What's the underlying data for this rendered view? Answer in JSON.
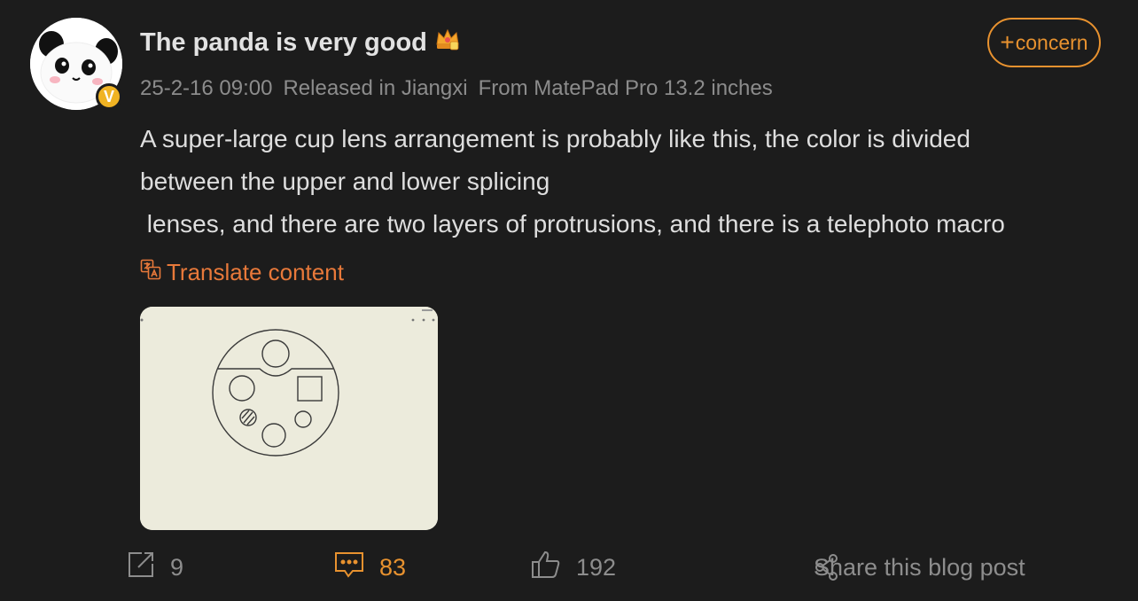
{
  "post": {
    "username": "The panda is very good",
    "timestamp": "25-2-16 09:00",
    "location": "Released in Jiangxi",
    "device": "From MatePad Pro 13.2 inches",
    "follow_label": "concern",
    "follow_plus": "+",
    "verified_badge": "V",
    "content_lines": [
      "A super-large cup lens arrangement is probably like this, the color is divided",
      "between the upper and lower splicing",
      " lenses, and there are two layers of protrusions, and there is a telephoto macro"
    ],
    "translate_label": "Translate content",
    "image_icon": "sketch-image"
  },
  "actions": {
    "repost_count": "9",
    "comment_count": "83",
    "like_count": "192",
    "share_label": "Share this blog post"
  },
  "colors": {
    "background": "#1c1c1c",
    "accent_orange": "#e8922f",
    "translate_orange": "#e8793a",
    "verified_yellow": "#f0b323",
    "muted_text": "#8c8c8c"
  }
}
